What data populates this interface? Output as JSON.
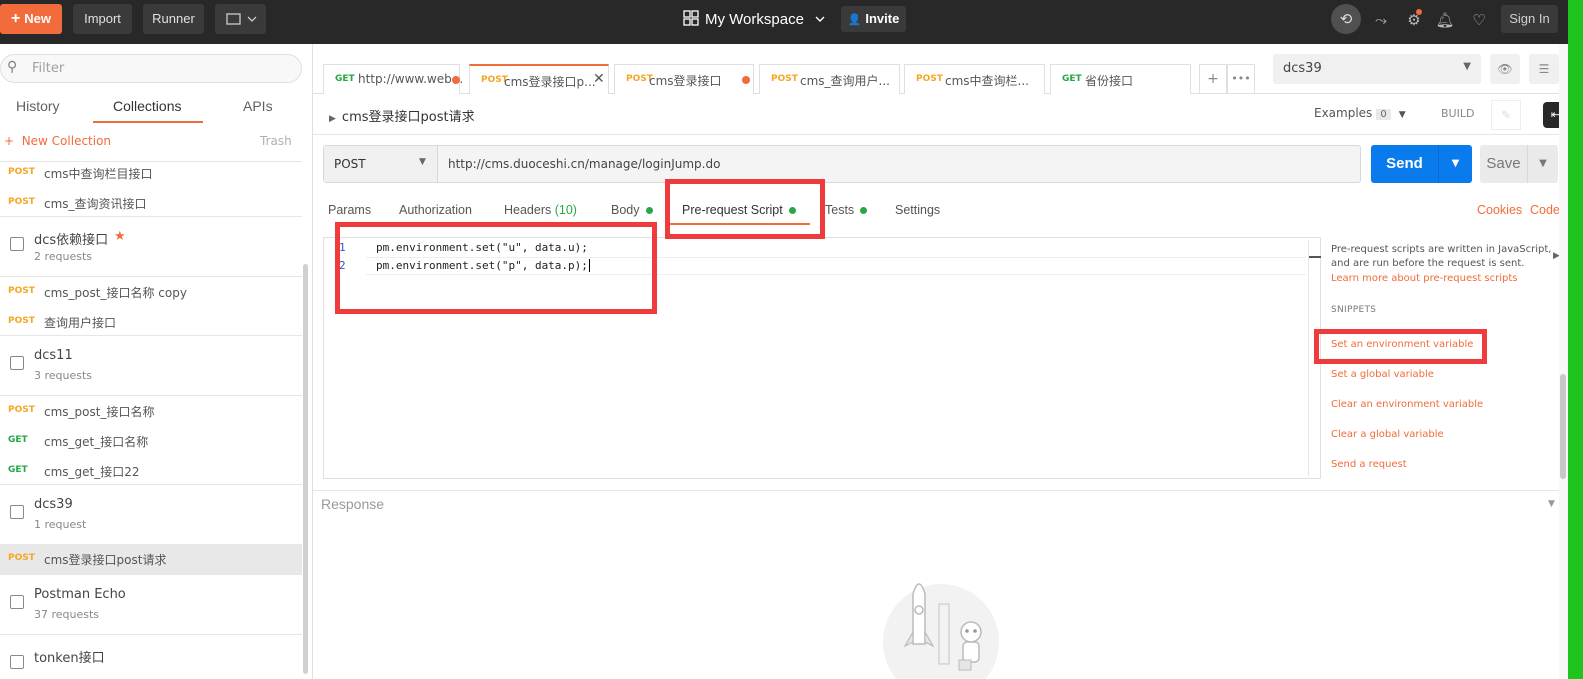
{
  "topbar": {
    "new_label": "New",
    "import_label": "Import",
    "runner_label": "Runner",
    "workspace_label": "My Workspace",
    "invite_label": "Invite",
    "signin_label": "Sign In"
  },
  "sidebar": {
    "filter_placeholder": "Filter",
    "tabs": [
      "History",
      "Collections",
      "APIs"
    ],
    "new_collection": "New Collection",
    "trash": "Trash",
    "requests": [
      {
        "method": "POST",
        "name": "cms中查询栏目接口"
      },
      {
        "method": "POST",
        "name": "cms_查询资讯接口"
      },
      {
        "method": "POST",
        "name": "cms_post_接口名称 copy"
      },
      {
        "method": "POST",
        "name": "查询用户接口"
      },
      {
        "method": "POST",
        "name": "cms_post_接口名称"
      },
      {
        "method": "GET",
        "name": "cms_get_接口名称"
      },
      {
        "method": "GET",
        "name": "cms_get_接口22"
      },
      {
        "method": "POST",
        "name": "cms登录接口post请求"
      }
    ],
    "collections": [
      {
        "name": "dcs依赖接口",
        "count": "2 requests"
      },
      {
        "name": "dcs11",
        "count": "3 requests"
      },
      {
        "name": "dcs39",
        "count": "1 request"
      },
      {
        "name": "Postman Echo",
        "count": "37 requests"
      },
      {
        "name": "tonken接口",
        "count": ""
      }
    ]
  },
  "request_tabs": [
    {
      "method": "GET",
      "name": "http://www.web..."
    },
    {
      "method": "POST",
      "name": "cms登录接口p..."
    },
    {
      "method": "POST",
      "name": "cms登录接口"
    },
    {
      "method": "POST",
      "name": "cms_查询用户..."
    },
    {
      "method": "POST",
      "name": "cms中查询栏..."
    },
    {
      "method": "GET",
      "name": "省份接口"
    }
  ],
  "environment": "dcs39",
  "request": {
    "name": "cms登录接口post请求",
    "examples_label": "Examples",
    "examples_count": "0",
    "build_label": "BUILD",
    "method": "POST",
    "url": "http://cms.duoceshi.cn/manage/loginJump.do",
    "send_label": "Send",
    "save_label": "Save"
  },
  "section_tabs": {
    "params": "Params",
    "authorization": "Authorization",
    "headers": "Headers",
    "headers_count": "(10)",
    "body": "Body",
    "prerequest": "Pre-request Script",
    "tests": "Tests",
    "settings": "Settings",
    "cookies": "Cookies",
    "code": "Code"
  },
  "editor": {
    "lines": [
      {
        "num": "1",
        "code": "pm.environment.set(\"u\", data.u);"
      },
      {
        "num": "2",
        "code": "pm.environment.set(\"p\", data.p);"
      }
    ]
  },
  "snippets": {
    "description": "Pre-request scripts are written in JavaScript, and are run before the request is sent.",
    "learn_more": "Learn more about pre-request scripts",
    "title": "SNIPPETS",
    "items": [
      "Set an environment variable",
      "Set a global variable",
      "Clear an environment variable",
      "Clear a global variable",
      "Send a request"
    ]
  },
  "response_label": "Response"
}
